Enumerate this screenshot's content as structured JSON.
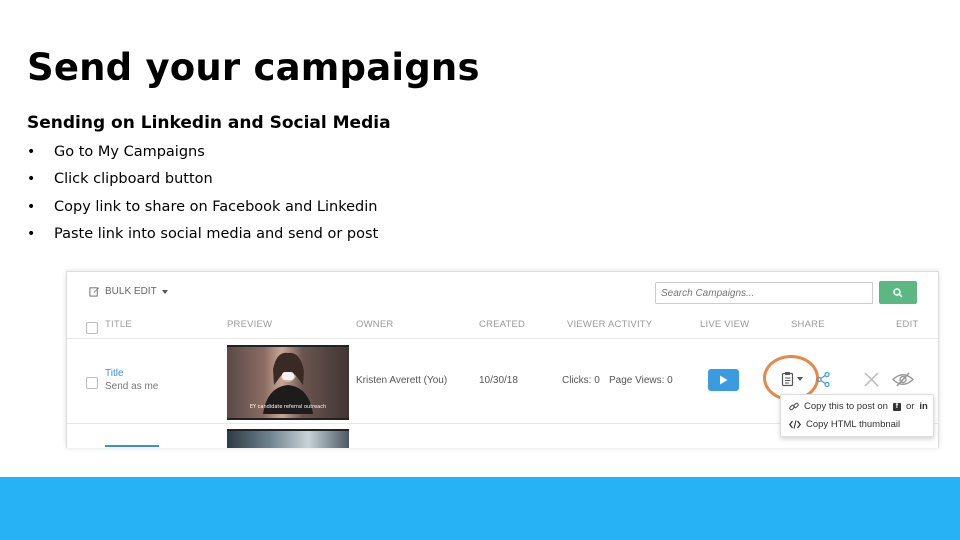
{
  "slide": {
    "title": "Send your campaigns",
    "subtitle": "Sending on Linkedin and Social Media",
    "bullets": [
      "Go to My Campaigns",
      "Click clipboard button",
      "Copy link to share on Facebook and Linkedin",
      "Paste link into social media and send or post"
    ]
  },
  "toolbar": {
    "bulk_edit_label": "BULK EDIT",
    "search_placeholder": "Search Campaigns..."
  },
  "table": {
    "headers": {
      "title": "TITLE",
      "preview": "PREVIEW",
      "owner": "OWNER",
      "created": "CREATED",
      "viewer_activity": "VIEWER ACTIVITY",
      "live_view": "LIVE VIEW",
      "share": "SHARE",
      "edit": "EDIT"
    },
    "rows": [
      {
        "title": "Title",
        "subtitle": "Send as me",
        "thumbnail_caption": "EY  candidate referral  outreach",
        "owner": "Kristen Averett (You)",
        "created": "10/30/18",
        "clicks": "Clicks: 0",
        "page_views": "Page Views: 0"
      }
    ]
  },
  "share_menu": {
    "copy_post_label": "Copy this to post on",
    "facebook_glyph": "f",
    "or_label": "or",
    "linkedin_label": "in",
    "copy_html_label": "Copy HTML thumbnail"
  },
  "icons": {
    "bulk_edit": "edit-icon",
    "search": "search-icon",
    "play": "play-icon",
    "clipboard": "clipboard-icon",
    "share": "share-icon",
    "delete": "close-icon",
    "visibility": "eye-slash-icon",
    "link": "link-icon",
    "code": "code-icon"
  },
  "colors": {
    "band": "#28b2f6",
    "search_button": "#5cb882",
    "play_button": "#3a9bde",
    "highlight": "#e8874a",
    "link": "#3a8fd6"
  }
}
